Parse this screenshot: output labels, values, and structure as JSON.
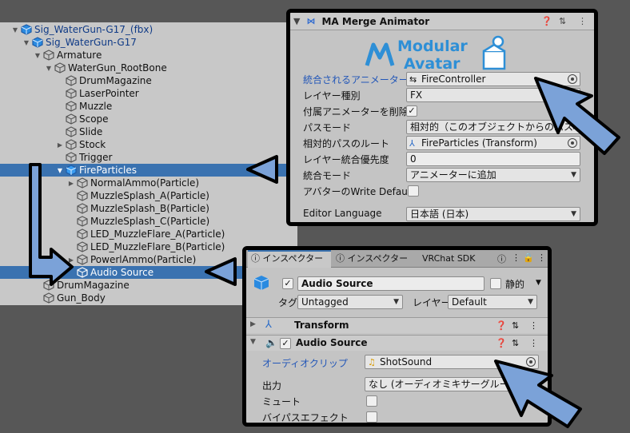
{
  "hierarchy": {
    "items": [
      {
        "label": "Sig_WaterGun-G17_(fbx)",
        "fold": "▼",
        "blue": true
      },
      {
        "label": "Sig_WaterGun-G17",
        "fold": "▼",
        "blue": true
      },
      {
        "label": "Armature",
        "fold": "▼"
      },
      {
        "label": "WaterGun_RootBone",
        "fold": "▼"
      },
      {
        "label": "DrumMagazine",
        "fold": ""
      },
      {
        "label": "LaserPointer",
        "fold": ""
      },
      {
        "label": "Muzzle",
        "fold": ""
      },
      {
        "label": "Scope",
        "fold": ""
      },
      {
        "label": "Slide",
        "fold": ""
      },
      {
        "label": "Stock",
        "fold": "▶"
      },
      {
        "label": "Trigger",
        "fold": ""
      },
      {
        "label": "FireParticles",
        "fold": "▼",
        "selected": true
      },
      {
        "label": "NormalAmmo(Particle)",
        "fold": "▶"
      },
      {
        "label": "MuzzleSplash_A(Particle)",
        "fold": ""
      },
      {
        "label": "MuzzleSplash_B(Particle)",
        "fold": ""
      },
      {
        "label": "MuzzleSplash_C(Particle)",
        "fold": ""
      },
      {
        "label": "LED_MuzzleFlare_A(Particle)",
        "fold": ""
      },
      {
        "label": "LED_MuzzleFlare_B(Particle)",
        "fold": ""
      },
      {
        "label": "PowerlAmmo(Particle)",
        "fold": "▶"
      },
      {
        "label": "Audio Source",
        "fold": "",
        "selected": true
      },
      {
        "label": "DrumMagazine",
        "fold": ""
      },
      {
        "label": "Gun_Body",
        "fold": ""
      }
    ]
  },
  "ma": {
    "title": "MA Merge Animator",
    "logo_line1": "Modular",
    "logo_line2": "Avatar",
    "rows": {
      "animator_label": "統合されるアニメーター",
      "animator_value": "FireController",
      "layer_type_label": "レイヤー種別",
      "layer_type_value": "FX",
      "delete_attached_label": "付属アニメーターを削除",
      "path_mode_label": "パスモード",
      "path_mode_value": "相対的（このオブジェクトからのパスを使用）",
      "relative_root_label": "相対的パスのルート",
      "relative_root_value": "FireParticles (Transform)",
      "priority_label": "レイヤー統合優先度",
      "priority_value": "0",
      "merge_mode_label": "統合モード",
      "merge_mode_value": "アニメーターに追加",
      "write_default_label": "アバターのWrite Default",
      "language_label": "Editor Language",
      "language_value": "日本語 (日本)"
    },
    "delete_attached_checked": "✓"
  },
  "inspector": {
    "tabs": [
      "インスペクター",
      "インスペクター",
      "VRChat SDK"
    ],
    "object_name": "Audio Source",
    "object_enabled": "✓",
    "static_label": "静的",
    "tag_label": "タグ",
    "tag_value": "Untagged",
    "layer_label": "レイヤー",
    "layer_value": "Default",
    "transform_title": "Transform",
    "audio_title": "Audio Source",
    "audio_enabled": "✓",
    "clip_label": "オーディオクリップ",
    "clip_value": "ShotSound",
    "output_label": "出力",
    "output_value": "なし (オーディオミキサーグループ)",
    "mute_label": "ミュート",
    "bypass_label": "バイパスエフェクト"
  },
  "colors": {
    "accent": "#3a72b0",
    "arrow_fill": "#7ba2d8",
    "panel": "#c4c4c4"
  }
}
